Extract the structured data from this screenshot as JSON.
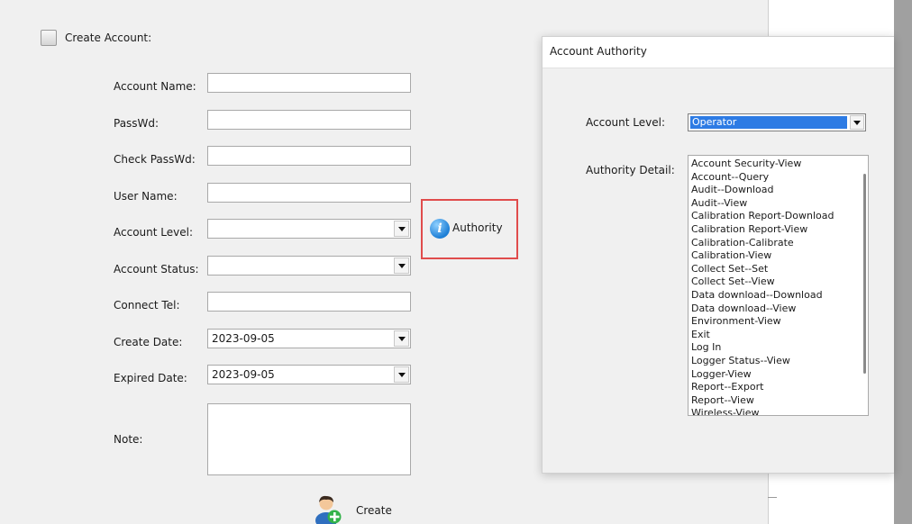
{
  "create_account": {
    "header_label": "Create Account:",
    "labels": {
      "account_name": "Account Name:",
      "passwd": "PassWd:",
      "check_passwd": "Check PassWd:",
      "user_name": "User Name:",
      "account_level": "Account Level:",
      "account_status": "Account Status:",
      "connect_tel": "Connect Tel:",
      "create_date": "Create  Date:",
      "expired_date": "Expired Date:",
      "note": "Note:"
    },
    "values": {
      "account_name": "",
      "passwd": "",
      "check_passwd": "",
      "user_name": "",
      "account_level": "",
      "account_status": "",
      "connect_tel": "",
      "create_date": "2023-09-05",
      "expired_date": "2023-09-05",
      "note": ""
    },
    "authority_label": "Authority",
    "create_label": "Create"
  },
  "dialog": {
    "title": "Account Authority",
    "account_level_label": "Account Level:",
    "account_level_value": "Operator",
    "authority_detail_label": "Authority Detail:",
    "authority_items": [
      "Account Security-View",
      "Account--Query",
      "Audit--Download",
      "Audit--View",
      "Calibration Report-Download",
      "Calibration Report-View",
      "Calibration-Calibrate",
      "Calibration-View",
      "Collect Set--Set",
      "Collect Set--View",
      "Data download--Download",
      "Data download--View",
      "Environment-View",
      "Exit",
      "Log In",
      "Logger Status--View",
      "Logger-View",
      "Report--Export",
      "Report--View",
      "Wireless-View"
    ]
  },
  "colors": {
    "highlight_border": "#e04c4c",
    "selection": "#2d7be4",
    "info_icon": "#1e7fd6",
    "create_icon_green": "#33b24a"
  }
}
